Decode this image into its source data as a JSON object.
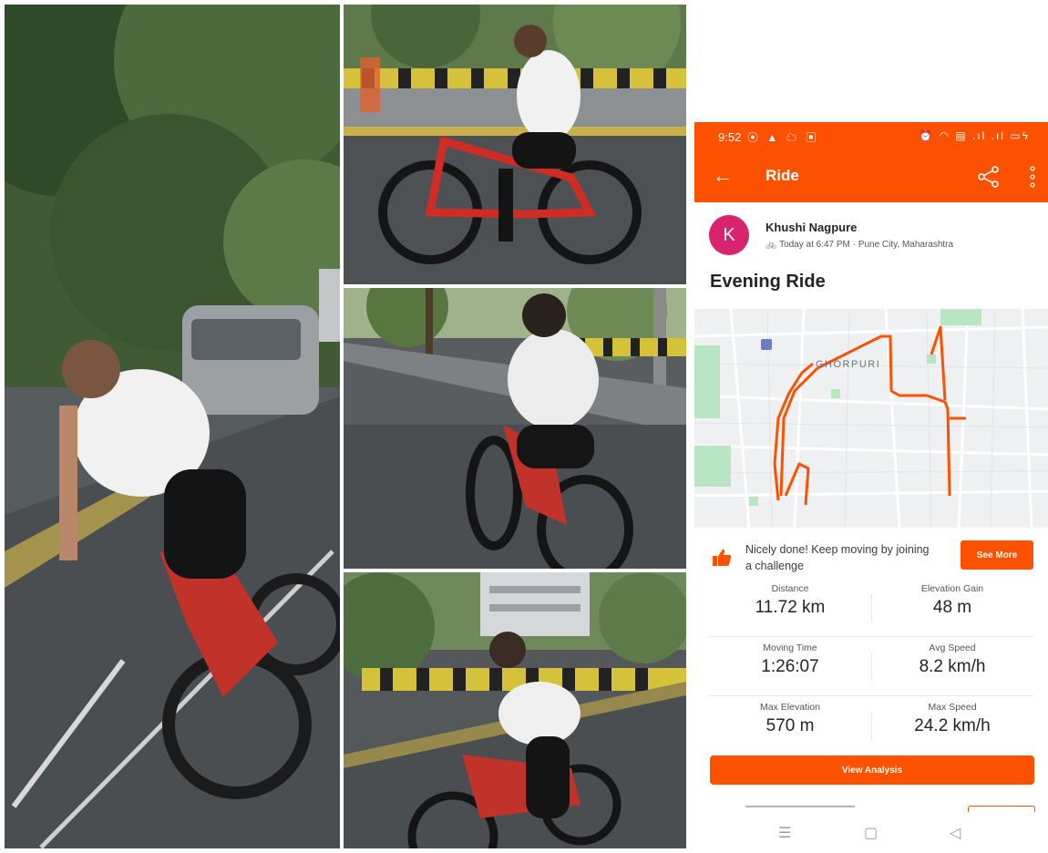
{
  "status_bar": {
    "time": "9:52",
    "left_icons": "⦿ ▲ ☁ ▣",
    "right_icons": "⏰ ◠ ▤ .ıl .ıl ▭ϟ"
  },
  "app_bar": {
    "back_icon": "←",
    "title": "Ride",
    "share_icon": "share-icon",
    "more_icon": "more-vertical-icon"
  },
  "athlete": {
    "avatar_letter": "K",
    "name": "Khushi Nagpure",
    "bike_icon": "🚲",
    "meta": "Today at 6:47 PM · Pune City, Maharashtra"
  },
  "activity": {
    "title": "Evening Ride",
    "map_label": "GHORPURI",
    "map_poi_icon": "transit-icon"
  },
  "challenge": {
    "text": "Nicely done! Keep moving by joining a challenge",
    "button": "See More"
  },
  "stats": [
    {
      "label": "Distance",
      "value": "11.72 km"
    },
    {
      "label": "Elevation Gain",
      "value": "48 m"
    },
    {
      "label": "Moving Time",
      "value": "1:26:07"
    },
    {
      "label": "Avg Speed",
      "value": "8.2 km/h"
    },
    {
      "label": "Max Elevation",
      "value": "570 m"
    },
    {
      "label": "Max Speed",
      "value": "24.2 km/h"
    }
  ],
  "view_analysis": "View Analysis",
  "nav": {
    "menu": "☰",
    "home": "▢",
    "back": "◁"
  },
  "colors": {
    "brand": "#fc5200",
    "avatar": "#d8246e",
    "route": "#fc5200",
    "map_park": "#b9e6c2"
  }
}
